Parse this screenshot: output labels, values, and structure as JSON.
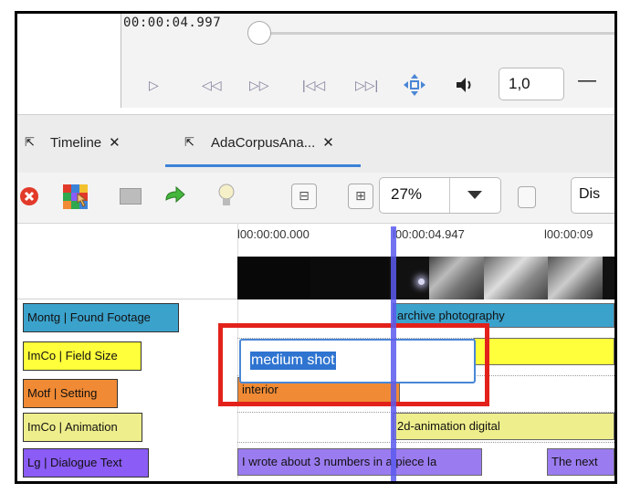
{
  "player": {
    "timecode": "00:00:04.997",
    "rate_value": "1,0",
    "minus_label": "—"
  },
  "tabs": [
    {
      "label": "Timeline",
      "close": "✕"
    },
    {
      "label": "AdaCorpusAna...",
      "close": "✕"
    }
  ],
  "toolbar": {
    "zoom_value": "27%",
    "dis_label": "Dis"
  },
  "ruler": {
    "times": [
      "l00:00:00.000",
      "l00:00:04.947",
      "l00:00:09"
    ]
  },
  "tracks": [
    {
      "label": "Montg | Found Footage",
      "color": "#3ba2cc"
    },
    {
      "label": "ImCo | Field Size",
      "color": "#ffff3c"
    },
    {
      "label": "Motf | Setting",
      "color": "#f08a34"
    },
    {
      "label": "ImCo | Animation",
      "color": "#eeee8c"
    },
    {
      "label": "Lg | Dialogue Text",
      "color": "#8b5cf6"
    }
  ],
  "annotations": {
    "archive": "archive photography",
    "interior": "interior",
    "animation": "2d-animation digital",
    "dialogue1": "I wrote about 3 numbers in a piece la",
    "dialogue2": "The next"
  },
  "editor": {
    "value": "medium shot"
  }
}
